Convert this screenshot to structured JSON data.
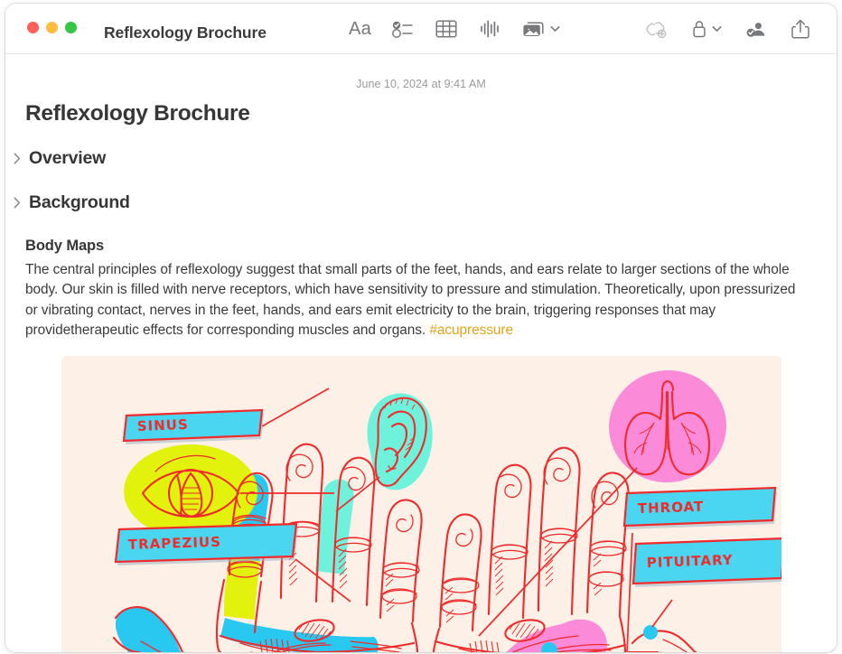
{
  "window": {
    "title": "Reflexology Brochure",
    "traffic_lights": [
      {
        "name": "close",
        "color": "#fc6058"
      },
      {
        "name": "minimize",
        "color": "#fdbc40"
      },
      {
        "name": "maximize",
        "color": "#33c748"
      }
    ]
  },
  "toolbar": {
    "center_items": [
      {
        "name": "format-text",
        "label": "Aa",
        "icon": "format-text-icon"
      },
      {
        "name": "checklist",
        "label": "Checklist",
        "icon": "checklist-icon"
      },
      {
        "name": "table",
        "label": "Table",
        "icon": "table-icon"
      },
      {
        "name": "audio",
        "label": "Audio",
        "icon": "audio-waveform-icon"
      },
      {
        "name": "media",
        "label": "Media",
        "icon": "media-photos-icon",
        "has_chevron": true
      }
    ],
    "right_items": [
      {
        "name": "link",
        "label": "Add Link",
        "icon": "link-add-icon",
        "dimmed": true
      },
      {
        "name": "lock",
        "label": "Lock Note",
        "icon": "lock-icon",
        "has_chevron": true
      },
      {
        "name": "share-people",
        "label": "Collaborate",
        "icon": "person-badge-check-icon"
      },
      {
        "name": "share",
        "label": "Share",
        "icon": "share-up-arrow-icon"
      }
    ]
  },
  "note": {
    "date": "June 10, 2024 at 9:41 AM",
    "heading": "Reflexology Brochure",
    "collapsed_sections": [
      {
        "label": "Overview",
        "disclosure": "chevron-right-icon"
      },
      {
        "label": "Background",
        "disclosure": "chevron-right-icon"
      }
    ],
    "body_section": {
      "title": "Body Maps",
      "paragraph": "The central principles of reflexology suggest that small parts of the feet, hands, and ears relate to larger sections of the whole body. Our skin is filled with nerve receptors, which have sensitivity to pressure and stimulation. Theoretically, upon pressurized or vibrating contact, nerves in the feet, hands, and ears emit electricity to the brain, triggering responses that may providetherapeutic effects for corresponding muscles and organs. ",
      "hashtag": "#acupressure"
    }
  },
  "illustration": {
    "name": "reflexology-hands-diagram",
    "background_color": "#fdf0e7",
    "ink_color": "#ef2b2b",
    "labels": [
      {
        "text": "SINUS",
        "fill": "#4ad6f0"
      },
      {
        "text": "TRAPEZIUS",
        "fill": "#4ad6f0"
      },
      {
        "text": "THROAT",
        "fill": "#4ad6f0"
      },
      {
        "text": "PITUITARY",
        "fill": "#4ad6f0"
      }
    ],
    "organs": [
      {
        "name": "eye",
        "blob_color": "#e2f20c"
      },
      {
        "name": "ear",
        "blob_color": "#6ff2dc"
      },
      {
        "name": "lungs",
        "blob_color": "#fb8ad8"
      }
    ],
    "zone_colors": [
      "#29c8f0",
      "#e2f20c",
      "#6ff2dc",
      "#fb8ad8"
    ]
  }
}
